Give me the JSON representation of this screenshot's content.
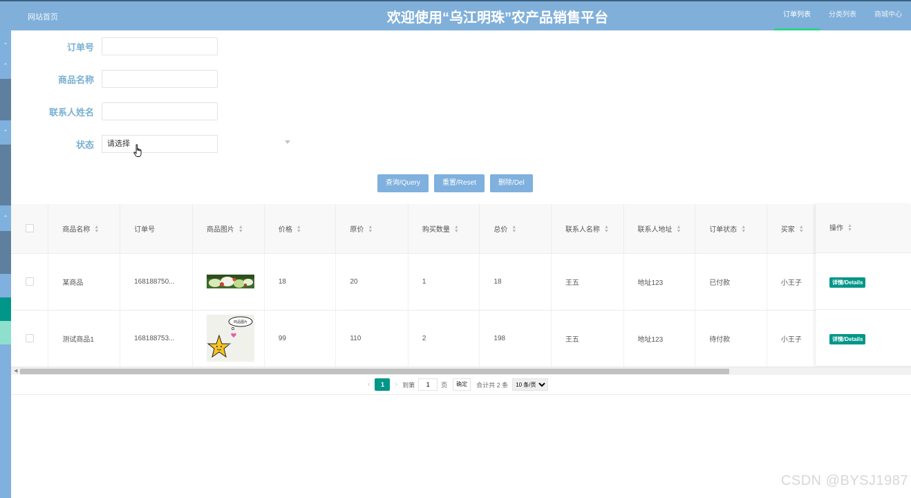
{
  "header": {
    "site_home": "网站首页",
    "title": "欢迎使用“乌江明珠”农产品销售平台",
    "nav": [
      "订单列表",
      "分类列表",
      "商城中心"
    ],
    "active_nav": "订单列表"
  },
  "filters": {
    "order_no_label": "订单号",
    "product_name_label": "商品名称",
    "contact_name_label": "联系人姓名",
    "status_label": "状态",
    "status_placeholder": "请选择",
    "order_no_value": "",
    "product_name_value": "",
    "contact_name_value": ""
  },
  "buttons": {
    "query": "查询/Query",
    "reset": "重置/Reset",
    "delete": "删除/Del"
  },
  "table": {
    "columns": [
      "商品名称",
      "订单号",
      "商品图片",
      "价格",
      "原价",
      "购买数量",
      "总价",
      "联系人名称",
      "联系人地址",
      "订单状态",
      "买家",
      "操作"
    ],
    "rows": [
      {
        "product_name": "某商品",
        "order_no": "168188750...",
        "image": "food-salad-image",
        "price": "18",
        "original_price": "20",
        "quantity": "1",
        "total": "18",
        "contact_name": "王五",
        "contact_address": "地址123",
        "status": "已付款",
        "buyer": "小王子",
        "action": "详情/Details"
      },
      {
        "product_name": "测试商品1",
        "order_no": "168188753...",
        "image": "cartoon-star-image",
        "image_caption": "商品图片",
        "price": "99",
        "original_price": "110",
        "quantity": "2",
        "total": "198",
        "contact_name": "王五",
        "contact_address": "地址123",
        "status": "待付款",
        "buyer": "小王子",
        "action": "详情/Details"
      }
    ]
  },
  "pagination": {
    "current_page": "1",
    "goto_label": "到第",
    "goto_value": "1",
    "page_unit": "页",
    "confirm": "确定",
    "total_text": "合计共 2 条",
    "page_size": "10 条/页"
  },
  "watermark": "CSDN @BYSJ1987",
  "colors": {
    "header_bg": "#80b0da",
    "accent_teal": "#009688",
    "button_blue": "#7fb0de",
    "label_blue": "#7ab0d2",
    "active_underline": "#2fd08c"
  }
}
